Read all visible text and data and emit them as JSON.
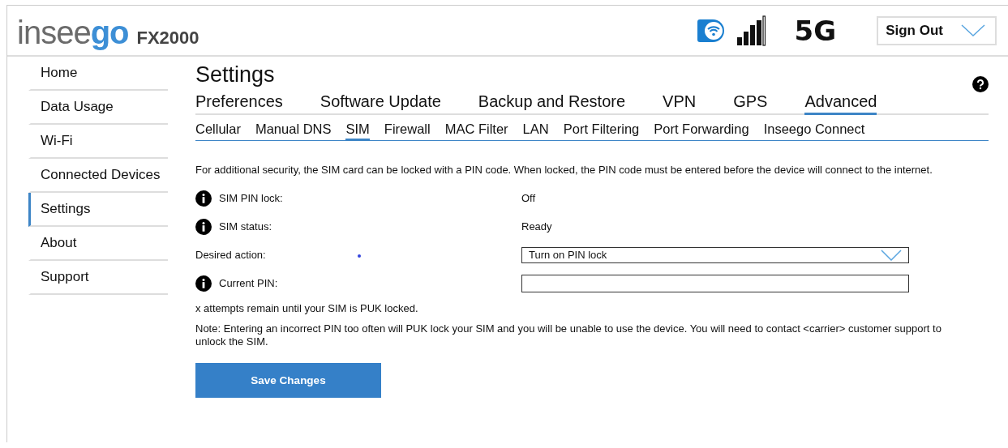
{
  "header": {
    "logo": "insee**go**",
    "model": "FX2000",
    "network": "5G",
    "sign_out": "Sign Out"
  },
  "sidebar": {
    "items": [
      {
        "label": "Home",
        "selected": false
      },
      {
        "label": "Data Usage",
        "selected": false
      },
      {
        "label": "Wi-Fi",
        "selected": false
      },
      {
        "label": "Connected Devices",
        "selected": false
      },
      {
        "label": "Settings",
        "selected": true
      },
      {
        "label": "About",
        "selected": false
      },
      {
        "label": "Support",
        "selected": false
      }
    ]
  },
  "page_title": "Settings",
  "tabs": [
    {
      "label": "Preferences",
      "selected": false
    },
    {
      "label": "Software Update",
      "selected": false
    },
    {
      "label": "Backup and Restore",
      "selected": false
    },
    {
      "label": "VPN",
      "selected": false
    },
    {
      "label": "GPS",
      "selected": false
    },
    {
      "label": "Advanced",
      "selected": true
    }
  ],
  "subtabs": [
    {
      "label": "Cellular",
      "selected": false
    },
    {
      "label": "Manual DNS",
      "selected": false
    },
    {
      "label": "SIM",
      "selected": true
    },
    {
      "label": "Firewall",
      "selected": false
    },
    {
      "label": "MAC Filter",
      "selected": false
    },
    {
      "label": "LAN",
      "selected": false
    },
    {
      "label": "Port Filtering",
      "selected": false
    },
    {
      "label": "Port Forwarding",
      "selected": false
    },
    {
      "label": "Inseego Connect",
      "selected": false
    }
  ],
  "intro": "For additional security, the SIM card can be locked with a PIN code. When locked, the PIN code must be entered before the device will connect to the internet.",
  "fields": [
    {
      "kind": "text",
      "label": "SIM PIN lock:",
      "info": true,
      "value": "Off"
    },
    {
      "kind": "text",
      "label": "SIM status:",
      "info": true,
      "value": "Ready"
    },
    {
      "kind": "select",
      "label": "Desired action:",
      "info": false,
      "value": "Turn on PIN lock"
    },
    {
      "kind": "input",
      "label": "Current PIN:",
      "info": true
    }
  ],
  "attempts_note": "x attempts remain until your SIM is PUK locked.",
  "warning": "Note: Entering an incorrect PIN too often will PUK lock your SIM and you will be unable to use the device. You will need to contact <carrier> customer support to unlock the SIM.",
  "save_button": "Save Changes"
}
